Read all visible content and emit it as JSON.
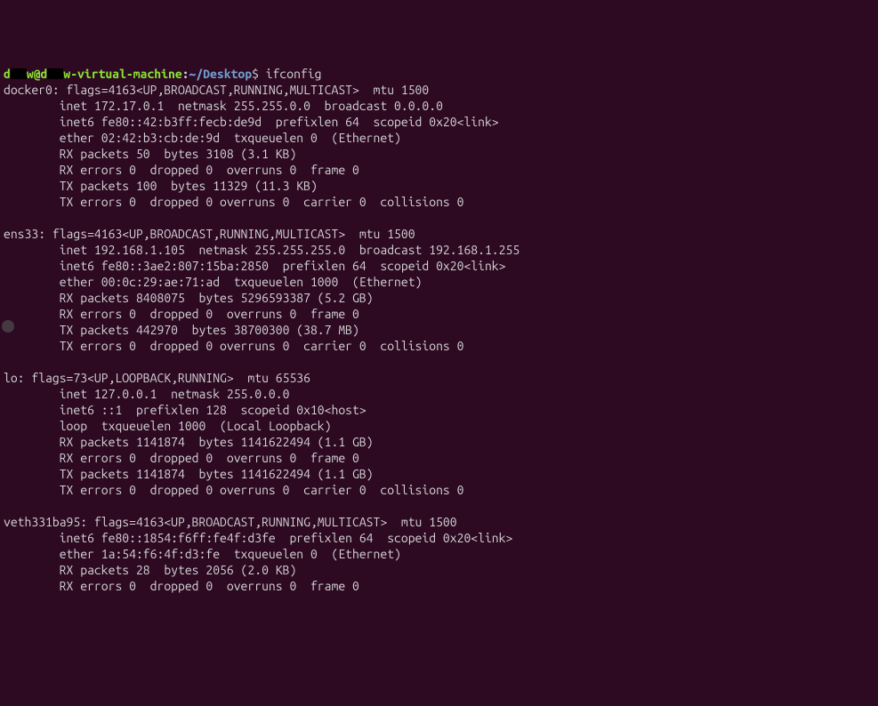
{
  "prompt": {
    "user_prefix": "d",
    "user_suffix": "w",
    "at": "@",
    "host_prefix": "d",
    "host_suffix": "w-virtual-machine",
    "colon": ":",
    "path": "~/Desktop",
    "dollar": "$",
    "command": "ifconfig"
  },
  "output": {
    "docker0": {
      "header": "docker0: flags=4163<UP,BROADCAST,RUNNING,MULTICAST>  mtu 1500",
      "inet": "        inet 172.17.0.1  netmask 255.255.0.0  broadcast 0.0.0.0",
      "inet6": "        inet6 fe80::42:b3ff:fecb:de9d  prefixlen 64  scopeid 0x20<link>",
      "ether": "        ether 02:42:b3:cb:de:9d  txqueuelen 0  (Ethernet)",
      "rxp": "        RX packets 50  bytes 3108 (3.1 KB)",
      "rxe": "        RX errors 0  dropped 0  overruns 0  frame 0",
      "txp": "        TX packets 100  bytes 11329 (11.3 KB)",
      "txe": "        TX errors 0  dropped 0 overruns 0  carrier 0  collisions 0"
    },
    "ens33": {
      "header": "ens33: flags=4163<UP,BROADCAST,RUNNING,MULTICAST>  mtu 1500",
      "inet": "        inet 192.168.1.105  netmask 255.255.255.0  broadcast 192.168.1.255",
      "inet6": "        inet6 fe80::3ae2:807:15ba:2850  prefixlen 64  scopeid 0x20<link>",
      "ether": "        ether 00:0c:29:ae:71:ad  txqueuelen 1000  (Ethernet)",
      "rxp": "        RX packets 8408075  bytes 5296593387 (5.2 GB)",
      "rxe": "        RX errors 0  dropped 0  overruns 0  frame 0",
      "txp": "        TX packets 442970  bytes 38700300 (38.7 MB)",
      "txe": "        TX errors 0  dropped 0 overruns 0  carrier 0  collisions 0"
    },
    "lo": {
      "header": "lo: flags=73<UP,LOOPBACK,RUNNING>  mtu 65536",
      "inet": "        inet 127.0.0.1  netmask 255.0.0.0",
      "inet6": "        inet6 ::1  prefixlen 128  scopeid 0x10<host>",
      "loop": "        loop  txqueuelen 1000  (Local Loopback)",
      "rxp": "        RX packets 1141874  bytes 1141622494 (1.1 GB)",
      "rxe": "        RX errors 0  dropped 0  overruns 0  frame 0",
      "txp": "        TX packets 1141874  bytes 1141622494 (1.1 GB)",
      "txe": "        TX errors 0  dropped 0 overruns 0  carrier 0  collisions 0"
    },
    "veth": {
      "header": "veth331ba95: flags=4163<UP,BROADCAST,RUNNING,MULTICAST>  mtu 1500",
      "inet6": "        inet6 fe80::1854:f6ff:fe4f:d3fe  prefixlen 64  scopeid 0x20<link>",
      "ether": "        ether 1a:54:f6:4f:d3:fe  txqueuelen 0  (Ethernet)",
      "rxp": "        RX packets 28  bytes 2056 (2.0 KB)",
      "rxe": "        RX errors 0  dropped 0  overruns 0  frame 0"
    }
  }
}
